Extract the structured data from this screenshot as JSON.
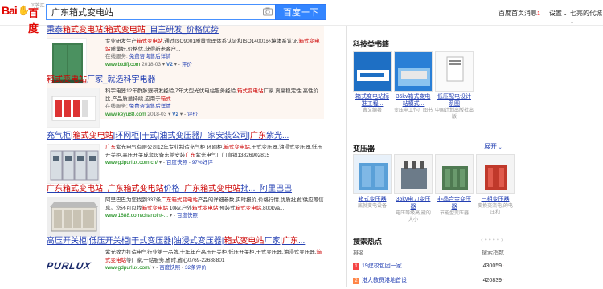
{
  "header": {
    "logo_text_1": "Bai",
    "logo_text_2": "百度",
    "logo_sub": "问答汇",
    "search_value": "广东箱式变电站",
    "search_button": "百度一下",
    "nav": [
      "百度首页",
      "消息",
      "设置",
      "七亮的代城"
    ],
    "nav_badge": "1"
  },
  "results": [
    {
      "title": "秉泰箱式变电站:箱式变电站_自主研发_价格优势",
      "title_em": [
        "箱式变电站",
        "箱式变电站"
      ],
      "desc": "专业研发生产箱式变电站,通过ISO9001质量管理体系认证和ISO14001环境体系认证,箱式变电站质量好,价格优,获得新老客户...",
      "tag_label": "在线服务:",
      "tag_link": "免费咨询售后详情",
      "url": "www.btdlfj.com",
      "date": "2018-03",
      "v": "V2",
      "comment": "评价",
      "thumb": "green-cabinet"
    },
    {
      "title": "箱式变电站厂家_就选科宇电器",
      "desc": "科宇电器12年群脉器研发经验,7年大型光伏电站服务经验,箱式变电站厂家 真高稳定性,高性价比,产品质量持续,应用于箱式...",
      "tag_label": "在线服务:",
      "tag_link": "免费咨询售后详情",
      "url": "www.keyu88.com",
      "date": "2018-03",
      "v": "V2",
      "comment": "评价",
      "thumb": "breakers"
    },
    {
      "title": "充气柜|箱式变电站|环网柜|干式|油式变压器厂家安装公司|广东紫光...",
      "desc": "广东紫光电气有限公司12年专业制造充气柜 环网柜,箱式变电站,干式变压器,油浸式变压器,低压开关柜,高压开关成套设备东莞安装广东紫光电气厂门直销13826902815",
      "url": "www.gdpurlux.com.cn/",
      "cache": "百度快照",
      "rate": "97%好评",
      "thumb": "switchgear"
    },
    {
      "title": "广东箱式变电站_广东箱式变电站价格_广东箱式变电站批..._阿里巴巴",
      "desc": "阿里巴巴为您找到337条广东箱式变电站产品的详细参数,实时报价,价格行情,优质批发/供应等信息。您还可以找箱式变电站 10kv,户外箱式变电站,预装式箱式变电站,800kva...",
      "url": "www.1688.com/chanpin/-...",
      "cache": "百度快照",
      "thumb": "boxsub"
    },
    {
      "title": "高压开关柜|低压开关柜|干式变压器|油浸式变压器|箱式变电站厂家|广东...",
      "desc": "紫光致力打造电气行业第一品牌,十年年产高压开关柜,低压开关柜,干式变压器,油浸式变压器,箱式变电站等厂家,一站服务,省时,省心0769-22688801",
      "url": "www.gdpurlux.com/",
      "cache": "百度快照",
      "comments": "32条评价",
      "thumb": "purlux",
      "thumb_text": "PURLUX"
    }
  ],
  "sidebar": {
    "books_title": "科技类书籍",
    "books": [
      {
        "name": "箱式变电站标准工程...",
        "sub": "曹文编著"
      },
      {
        "name": "35kv箱式变电站模式...",
        "sub": "变压电工作厂图书"
      },
      {
        "name": "低压配电设计系图",
        "sub": "中国计划出版社出版"
      }
    ],
    "trans_title": "变压器",
    "unfold": "展开",
    "trans": [
      {
        "name": "箱式变压器",
        "sub": "底就变电设备"
      },
      {
        "name": "35kv电力变压器",
        "sub": "电压等级高,能的大小"
      },
      {
        "name": "非晶合金变压器",
        "sub": "节能型变压器"
      },
      {
        "name": "三相变压器",
        "sub": "变换交流电,的电压和"
      }
    ],
    "hot_title": "搜索热点",
    "hot_head_rank": "排名",
    "hot_head_index": "搜索指数",
    "hot": [
      {
        "rank": "1",
        "text": "19建校包团一家",
        "value": "430059",
        "color": "#f54545"
      },
      {
        "rank": "2",
        "text": "港大教员港地首设",
        "value": "420839",
        "color": "#ff8547"
      }
    ]
  },
  "colors": {
    "link": "#2440b3",
    "em": "#c00",
    "green": "#008000",
    "brand_blue": "#3385ff"
  }
}
